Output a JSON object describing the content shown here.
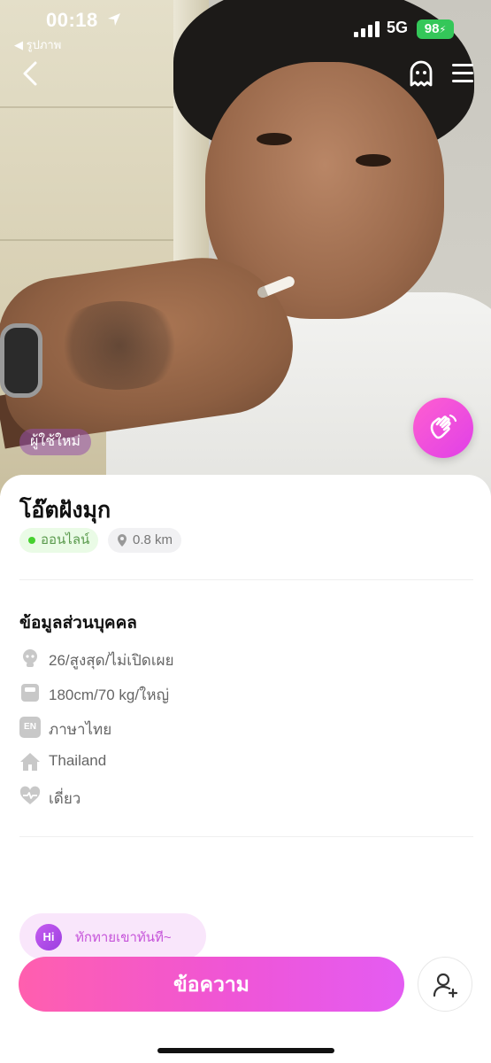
{
  "status_bar": {
    "time": "00:18",
    "back_app": "◀ รูปภาพ",
    "network": "5G",
    "battery": "98"
  },
  "profile": {
    "new_user_badge": "ผู้ใช้ใหม่",
    "name": "โอ๊ตฝังมุก",
    "online_label": "ออนไลน์",
    "distance": "0.8 km"
  },
  "personal_info": {
    "title": "ข้อมูลส่วนบุคคล",
    "rows": [
      {
        "icon": "face-icon",
        "text": "26/สูงสุด/ไม่เปิดเผย"
      },
      {
        "icon": "scale-icon",
        "text": "180cm/70 kg/ใหญ่"
      },
      {
        "icon": "language-icon",
        "text": "ภาษาไทย",
        "badge": "EN"
      },
      {
        "icon": "home-icon",
        "text": "Thailand"
      },
      {
        "icon": "heart-icon",
        "text": "เดี่ยว"
      }
    ]
  },
  "actions": {
    "greet_hint": "ทักทายเขาทันที~",
    "hi_label": "Hi",
    "message_label": "ข้อความ"
  },
  "colors": {
    "accent_pink": "#ef55d6",
    "online_green": "#46d12f",
    "battery_green": "#34c759"
  }
}
